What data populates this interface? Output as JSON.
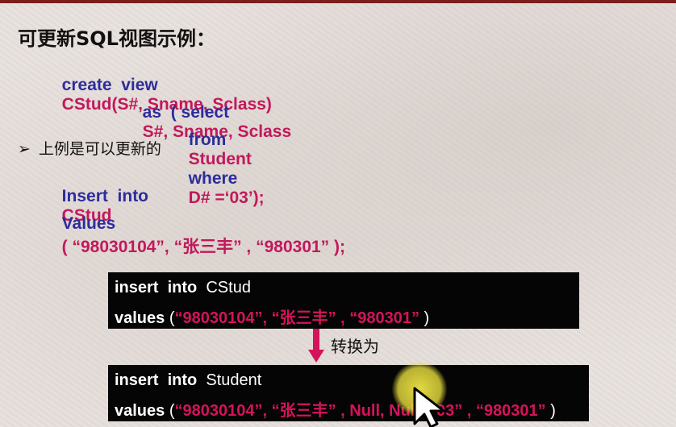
{
  "slide": {
    "title": "可更新SQL视图示例：",
    "create_view": {
      "kw_create_view": "create  view",
      "view_def": "CStud(S#, Sname, Sclass)",
      "kw_as_select": "as  ( select",
      "select_cols": "S#, Sname, Sclass",
      "kw_from": "from",
      "table": "Student",
      "kw_where": "where",
      "condition": "D# =‘03’);"
    },
    "bullet_text": "上例是可以更新的",
    "insert": {
      "kw_insert_into": "Insert  into",
      "target": "CStud",
      "kw_values": "Values",
      "values_text": "( “98030104”, “张三丰” , “980301” );"
    }
  },
  "box1": {
    "kw_insert_into": "insert  into",
    "target": "CStud",
    "kw_values": "values",
    "open": " (",
    "values_red": "“98030104”, “张三丰” , “980301”",
    "close": " )"
  },
  "convert_label": "转换为",
  "box2": {
    "kw_insert_into": "insert  into",
    "target": "Student",
    "kw_values": "values",
    "open": " (",
    "values_red": "“98030104”, “张三丰” , Null, Null, “03” , “980301”",
    "close": " )"
  },
  "colors": {
    "keyword_blue": "#2c2c9e",
    "name_magenta": "#c2185b",
    "box_background": "#050505",
    "highlight_red": "#d4145a",
    "pointer_yellow": "#eee446"
  }
}
